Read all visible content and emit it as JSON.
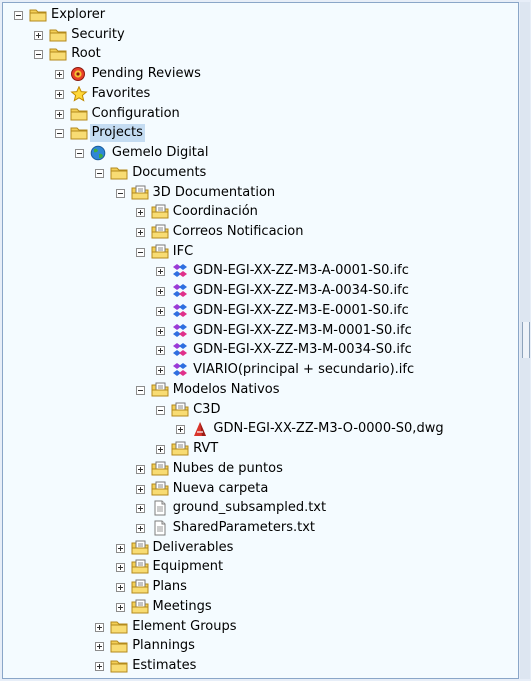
{
  "tree": [
    {
      "label": "Explorer",
      "icon": "folder-icon",
      "expander": "minus",
      "level": 0
    },
    {
      "label": "Security",
      "icon": "folder-icon",
      "expander": "plus",
      "level": 1
    },
    {
      "label": "Root",
      "icon": "folder-icon",
      "expander": "minus",
      "level": 1
    },
    {
      "label": "Pending Reviews",
      "icon": "pending-reviews-icon",
      "expander": "plus",
      "level": 2
    },
    {
      "label": "Favorites",
      "icon": "star-icon",
      "expander": "plus",
      "level": 2
    },
    {
      "label": "Configuration",
      "icon": "folder-icon",
      "expander": "plus",
      "level": 2
    },
    {
      "label": "Projects",
      "icon": "folder-icon",
      "expander": "minus",
      "level": 2,
      "selected": true
    },
    {
      "label": "Gemelo Digital",
      "icon": "globe-icon",
      "expander": "minus",
      "level": 3
    },
    {
      "label": "Documents",
      "icon": "folder-icon",
      "expander": "minus",
      "level": 4
    },
    {
      "label": "3D Documentation",
      "icon": "document-folder-icon",
      "expander": "minus",
      "level": 5
    },
    {
      "label": "Coordinación",
      "icon": "document-folder-icon",
      "expander": "plus",
      "level": 6
    },
    {
      "label": "Correos Notificacion",
      "icon": "document-folder-icon",
      "expander": "plus",
      "level": 6
    },
    {
      "label": "IFC",
      "icon": "document-folder-icon",
      "expander": "minus",
      "level": 6
    },
    {
      "label": "GDN-EGI-XX-ZZ-M3-A-0001-S0.ifc",
      "icon": "ifc-file-icon",
      "expander": "plus",
      "level": 7
    },
    {
      "label": "GDN-EGI-XX-ZZ-M3-A-0034-S0.ifc",
      "icon": "ifc-file-icon",
      "expander": "plus",
      "level": 7
    },
    {
      "label": "GDN-EGI-XX-ZZ-M3-E-0001-S0.ifc",
      "icon": "ifc-file-icon",
      "expander": "plus",
      "level": 7
    },
    {
      "label": "GDN-EGI-XX-ZZ-M3-M-0001-S0.ifc",
      "icon": "ifc-file-icon",
      "expander": "plus",
      "level": 7
    },
    {
      "label": "GDN-EGI-XX-ZZ-M3-M-0034-S0.ifc",
      "icon": "ifc-file-icon",
      "expander": "plus",
      "level": 7
    },
    {
      "label": "VIARIO(principal + secundario).ifc",
      "icon": "ifc-file-icon",
      "expander": "plus",
      "level": 7
    },
    {
      "label": "Modelos Nativos",
      "icon": "document-folder-icon",
      "expander": "minus",
      "level": 6
    },
    {
      "label": "C3D",
      "icon": "document-folder-icon",
      "expander": "minus",
      "level": 7
    },
    {
      "label": "GDN-EGI-XX-ZZ-M3-O-0000-S0,dwg",
      "icon": "dwg-file-icon",
      "expander": "plus",
      "level": 8
    },
    {
      "label": "RVT",
      "icon": "document-folder-icon",
      "expander": "plus",
      "level": 7
    },
    {
      "label": "Nubes de puntos",
      "icon": "document-folder-icon",
      "expander": "plus",
      "level": 6
    },
    {
      "label": "Nueva carpeta",
      "icon": "document-folder-icon",
      "expander": "plus",
      "level": 6
    },
    {
      "label": "ground_subsampled.txt",
      "icon": "text-file-icon",
      "expander": "plus",
      "level": 6
    },
    {
      "label": "SharedParameters.txt",
      "icon": "text-file-icon",
      "expander": "plus",
      "level": 6
    },
    {
      "label": "Deliverables",
      "icon": "document-folder-icon",
      "expander": "plus",
      "level": 5
    },
    {
      "label": "Equipment",
      "icon": "document-folder-icon",
      "expander": "plus",
      "level": 5
    },
    {
      "label": "Plans",
      "icon": "document-folder-icon",
      "expander": "plus",
      "level": 5
    },
    {
      "label": "Meetings",
      "icon": "document-folder-icon",
      "expander": "plus",
      "level": 5
    },
    {
      "label": "Element Groups",
      "icon": "folder-icon",
      "expander": "plus",
      "level": 4
    },
    {
      "label": "Plannings",
      "icon": "folder-icon",
      "expander": "plus",
      "level": 4
    },
    {
      "label": "Estimates",
      "icon": "folder-icon",
      "expander": "plus",
      "level": 4
    }
  ]
}
